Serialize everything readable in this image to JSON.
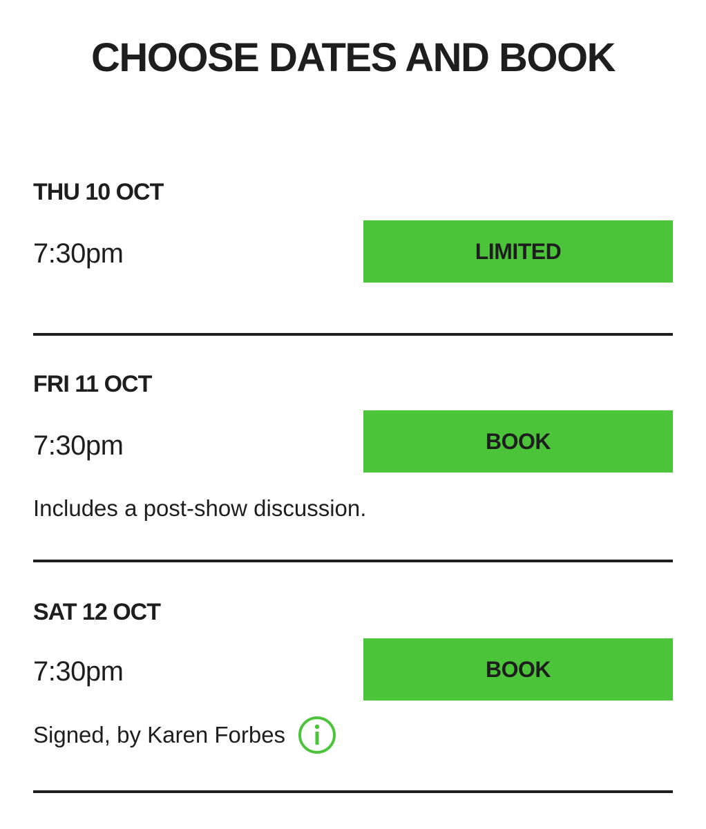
{
  "page": {
    "title": "CHOOSE DATES AND BOOK"
  },
  "performances": [
    {
      "date": "THU 10 OCT",
      "time": "7:30pm",
      "button_label": "LIMITED",
      "note": ""
    },
    {
      "date": "FRI 11 OCT",
      "time": "7:30pm",
      "button_label": "BOOK",
      "note": "Includes a post-show discussion."
    },
    {
      "date": "SAT 12 OCT",
      "time": "7:30pm",
      "button_label": "BOOK",
      "note": "Signed, by Karen Forbes",
      "note_icon": "info-icon"
    }
  ],
  "colors": {
    "accent": "#4cc43a",
    "text": "#1e1e1e",
    "divider": "#1e1e1e",
    "background": "#ffffff"
  }
}
